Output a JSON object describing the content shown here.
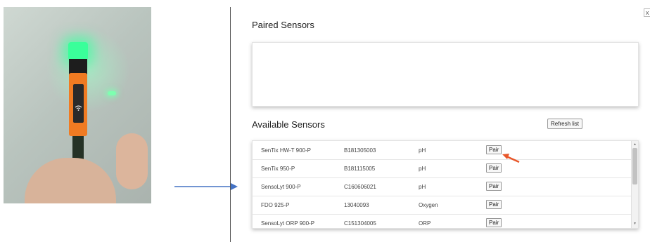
{
  "paired": {
    "title": "Paired Sensors"
  },
  "available": {
    "title": "Available Sensors",
    "refresh_label": "Refresh list",
    "rows": [
      {
        "name": "SenTix HW-T 900-P",
        "serial": "B181305003",
        "type": "pH",
        "action": "Pair"
      },
      {
        "name": "SenTix 950-P",
        "serial": "B181115005",
        "type": "pH",
        "action": "Pair"
      },
      {
        "name": "SensoLyt 900-P",
        "serial": "C160606021",
        "type": "pH",
        "action": "Pair"
      },
      {
        "name": "FDO 925-P",
        "serial": "13040093",
        "type": "Oxygen",
        "action": "Pair"
      },
      {
        "name": "SensoLyt ORP 900-P",
        "serial": "C151304005",
        "type": "ORP",
        "action": "Pair"
      }
    ]
  },
  "close_label": "x",
  "colors": {
    "arrow": "#4472c4",
    "annotation": "#e8572a",
    "device_orange": "#f07b22",
    "led_green": "#3aff9a"
  },
  "icons": {
    "device_panel": "wifi-icon"
  }
}
